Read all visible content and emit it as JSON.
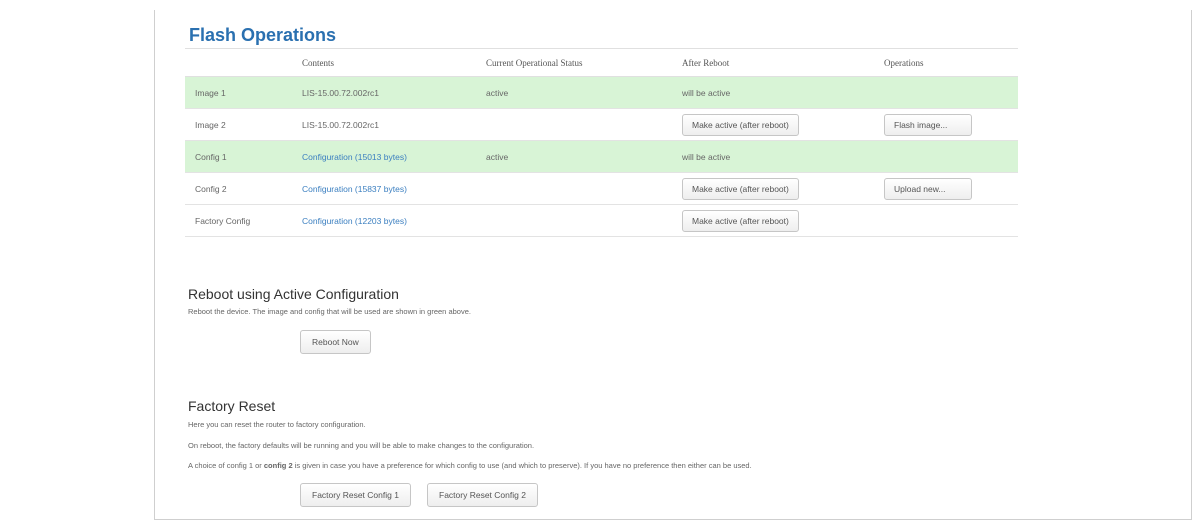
{
  "flash": {
    "title": "Flash Operations",
    "headers": [
      "",
      "Contents",
      "Current Operational Status",
      "After Reboot",
      "Operations"
    ],
    "rows": [
      {
        "name": "Image 1",
        "contents": "LIS-15.00.72.002rc1",
        "status": "active",
        "after": "will be active",
        "after_button": "",
        "op_button": ""
      },
      {
        "name": "Image 2",
        "contents": "LIS-15.00.72.002rc1",
        "status": "",
        "after": "",
        "after_button": "Make active (after reboot)",
        "op_button": "Flash image..."
      },
      {
        "name": "Config 1",
        "contents": "Configuration (15013 bytes)",
        "status": "active",
        "after": "will be active",
        "after_button": "",
        "op_button": ""
      },
      {
        "name": "Config 2",
        "contents": "Configuration (15837 bytes)",
        "status": "",
        "after": "",
        "after_button": "Make active (after reboot)",
        "op_button": "Upload new..."
      },
      {
        "name": "Factory Config",
        "contents": "Configuration (12203 bytes)",
        "status": "",
        "after": "",
        "after_button": "Make active (after reboot)",
        "op_button": ""
      }
    ]
  },
  "reboot": {
    "title": "Reboot using Active Configuration",
    "description": "Reboot the device. The image and config that will be used are shown in green above.",
    "button": "Reboot Now"
  },
  "factory_reset": {
    "title": "Factory Reset",
    "line1": "Here you can reset the router to factory configuration.",
    "line2": "On reboot, the factory defaults will be running and you will be able to make changes to the configuration.",
    "line3_prefix": "A choice of config 1 or ",
    "line3_bold": "config 2",
    "line3_suffix": " is given in case you have a preference for which config to use (and which to preserve). If you have no preference then either can be used.",
    "button1": "Factory Reset Config 1",
    "button2": "Factory Reset Config 2"
  },
  "colors": {
    "title": "#2a70b0",
    "active_row": "#d8f4d6",
    "link": "#3b7fc0"
  }
}
